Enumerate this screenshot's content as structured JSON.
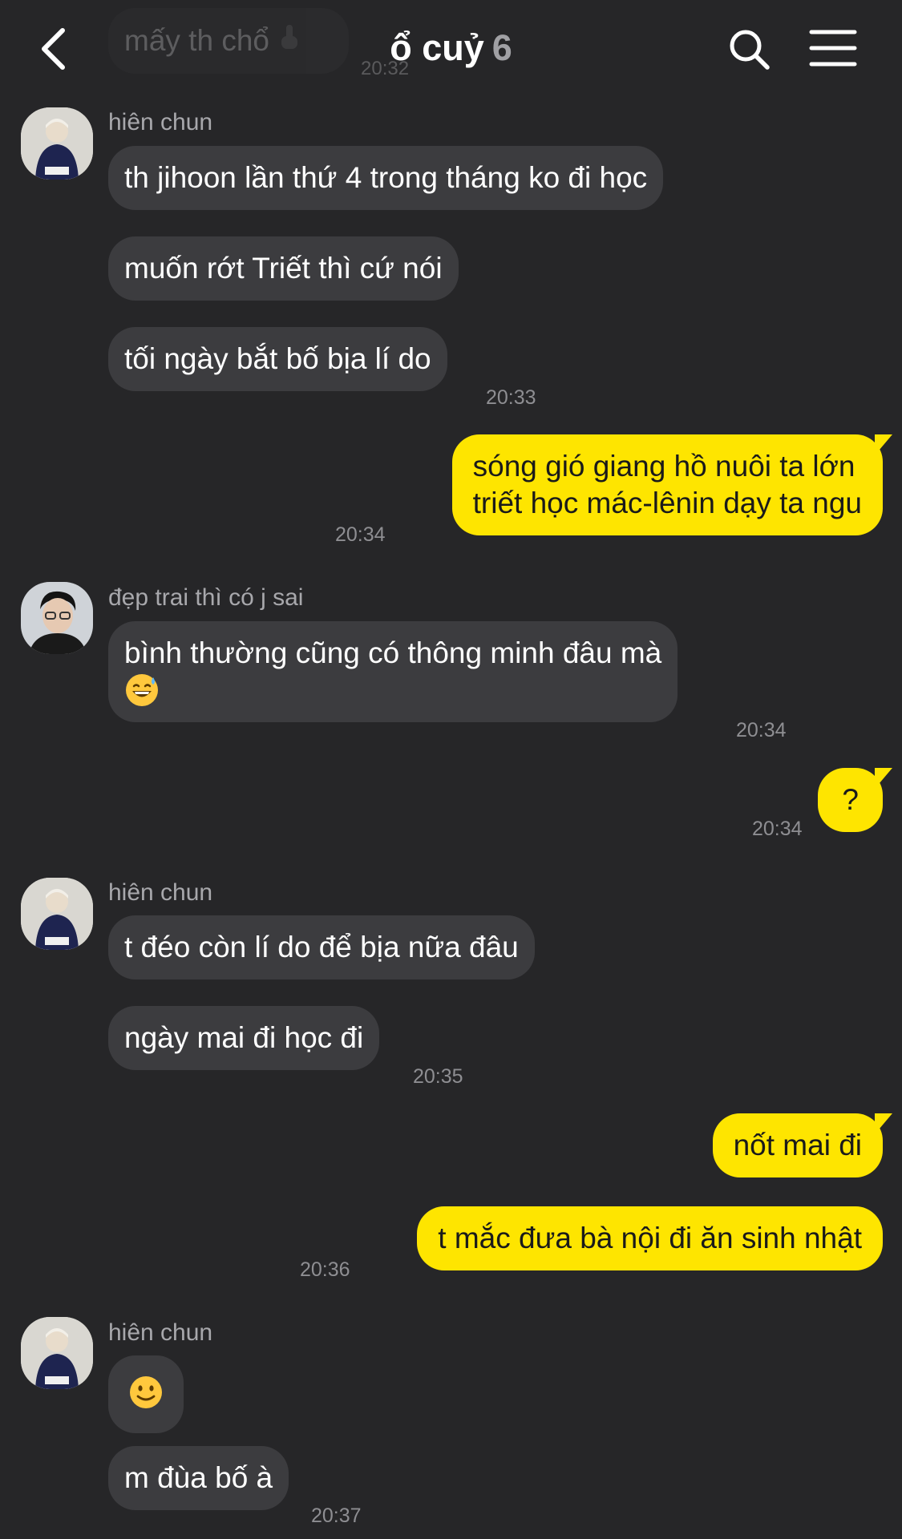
{
  "header": {
    "title": "ổ cuỷ",
    "member_count": "6",
    "previous_message_preview": "mấy th chổ",
    "previous_message_time": "20:32",
    "icons": {
      "back": "chevron-left-icon",
      "search": "search-icon",
      "menu": "hamburger-menu-icon"
    }
  },
  "colors": {
    "background": "#262628",
    "incoming_bubble": "#3c3c3f",
    "outgoing_bubble": "#fee500",
    "timestamp": "#8e8e92"
  },
  "messages": {
    "group1": {
      "sender": "hiên chun",
      "texts": [
        "th jihoon lần thứ 4 trong tháng ko đi học",
        "muốn rớt Triết thì cứ nói",
        "tối ngày bắt bố bịa lí do"
      ],
      "time": "20:33"
    },
    "out1": {
      "lines": [
        "sóng gió giang hồ nuôi ta lớn",
        "triết học mác-lênin dạy ta ngu"
      ],
      "time": "20:34"
    },
    "group2": {
      "sender": "đẹp trai thì có j sai",
      "lines": [
        "bình thường cũng có thông minh đâu mà"
      ],
      "emoji": "grinning-sweat-emoji",
      "time": "20:34"
    },
    "out2": {
      "text": "?",
      "time": "20:34"
    },
    "group3": {
      "sender": "hiên chun",
      "texts": [
        "t đéo còn lí do để bịa nữa đâu",
        "ngày mai đi học đi"
      ],
      "time": "20:35"
    },
    "out3": {
      "texts": [
        "nốt mai đi",
        "t mắc đưa bà nội đi ăn sinh nhật"
      ],
      "time": "20:36"
    },
    "group4": {
      "sender": "hiên chun",
      "emoji": "slightly-smiling-emoji",
      "texts": [
        "m đùa bố à"
      ],
      "time": "20:37"
    }
  }
}
